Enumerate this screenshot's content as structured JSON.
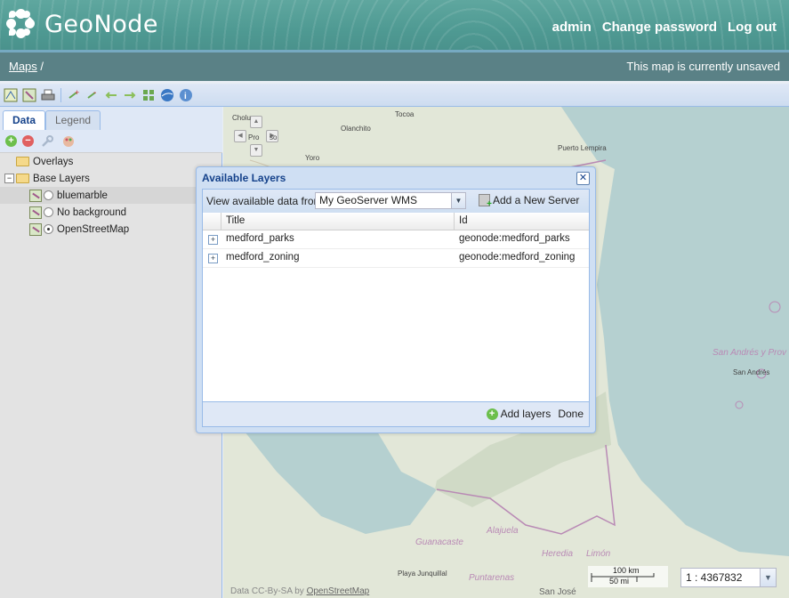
{
  "header": {
    "brand": "GeoNode",
    "user_links": [
      "admin",
      "Change password",
      "Log out"
    ]
  },
  "crumbs": {
    "maps_link": "Maps",
    "separator": "/",
    "status": "This map is currently unsaved"
  },
  "toolbar": {
    "icons": [
      "new-layer-icon",
      "layer-properties-icon",
      "print-icon",
      "zoom-in-icon",
      "zoom-out-icon",
      "back-icon",
      "forward-icon",
      "zoom-extent-icon",
      "google-earth-icon",
      "info-icon"
    ]
  },
  "panel": {
    "tabs": [
      "Data",
      "Legend"
    ],
    "active_tab": "Data"
  },
  "tree": {
    "overlays": "Overlays",
    "base_layers": "Base Layers",
    "layers": [
      {
        "label": "bluemarble",
        "selected": false,
        "highlighted": true
      },
      {
        "label": "No background",
        "selected": false,
        "highlighted": false
      },
      {
        "label": "OpenStreetMap",
        "selected": true,
        "highlighted": false
      }
    ]
  },
  "map": {
    "labels": {
      "tocoa": "Tocoa",
      "olanchito": "Olanchito",
      "yoro": "Yoro",
      "puerto_lempira": "Puerto Lempira",
      "san_andres_prov": "San Andrés y Prov",
      "san_andres": "San Andrés",
      "guanacaste": "Guanacaste",
      "alajuela": "Alajuela",
      "heredia": "Heredia",
      "limon": "Limón",
      "puntarenas": "Puntarenas",
      "playa_junquillal": "Playa Junquillal",
      "san_jose": "San José",
      "cholu": "Cholu",
      "progreso": "Pro",
      "progreso_suffix": "so"
    },
    "attribution_prefix": "Data CC-By-SA by",
    "attribution_link": "OpenStreetMap",
    "scale_km": "100 km",
    "scale_mi": "50 mi",
    "scale_value": "1 : 4367832"
  },
  "dialog": {
    "title": "Available Layers",
    "source_label": "View available data from:",
    "source_value": "My GeoServer WMS",
    "add_server": "Add a New Server",
    "columns": [
      "Title",
      "Id"
    ],
    "rows": [
      {
        "title": "medford_parks",
        "id": "geonode:medford_parks"
      },
      {
        "title": "medford_zoning",
        "id": "geonode:medford_zoning"
      }
    ],
    "add_layers": "Add layers",
    "done": "Done"
  },
  "colors": {
    "header_teal": "#4f9a93",
    "crumb_bar": "#5a8186",
    "ext_title_blue": "#15428b",
    "sea": "#b5d0d0",
    "land": "#d7dfd0"
  }
}
